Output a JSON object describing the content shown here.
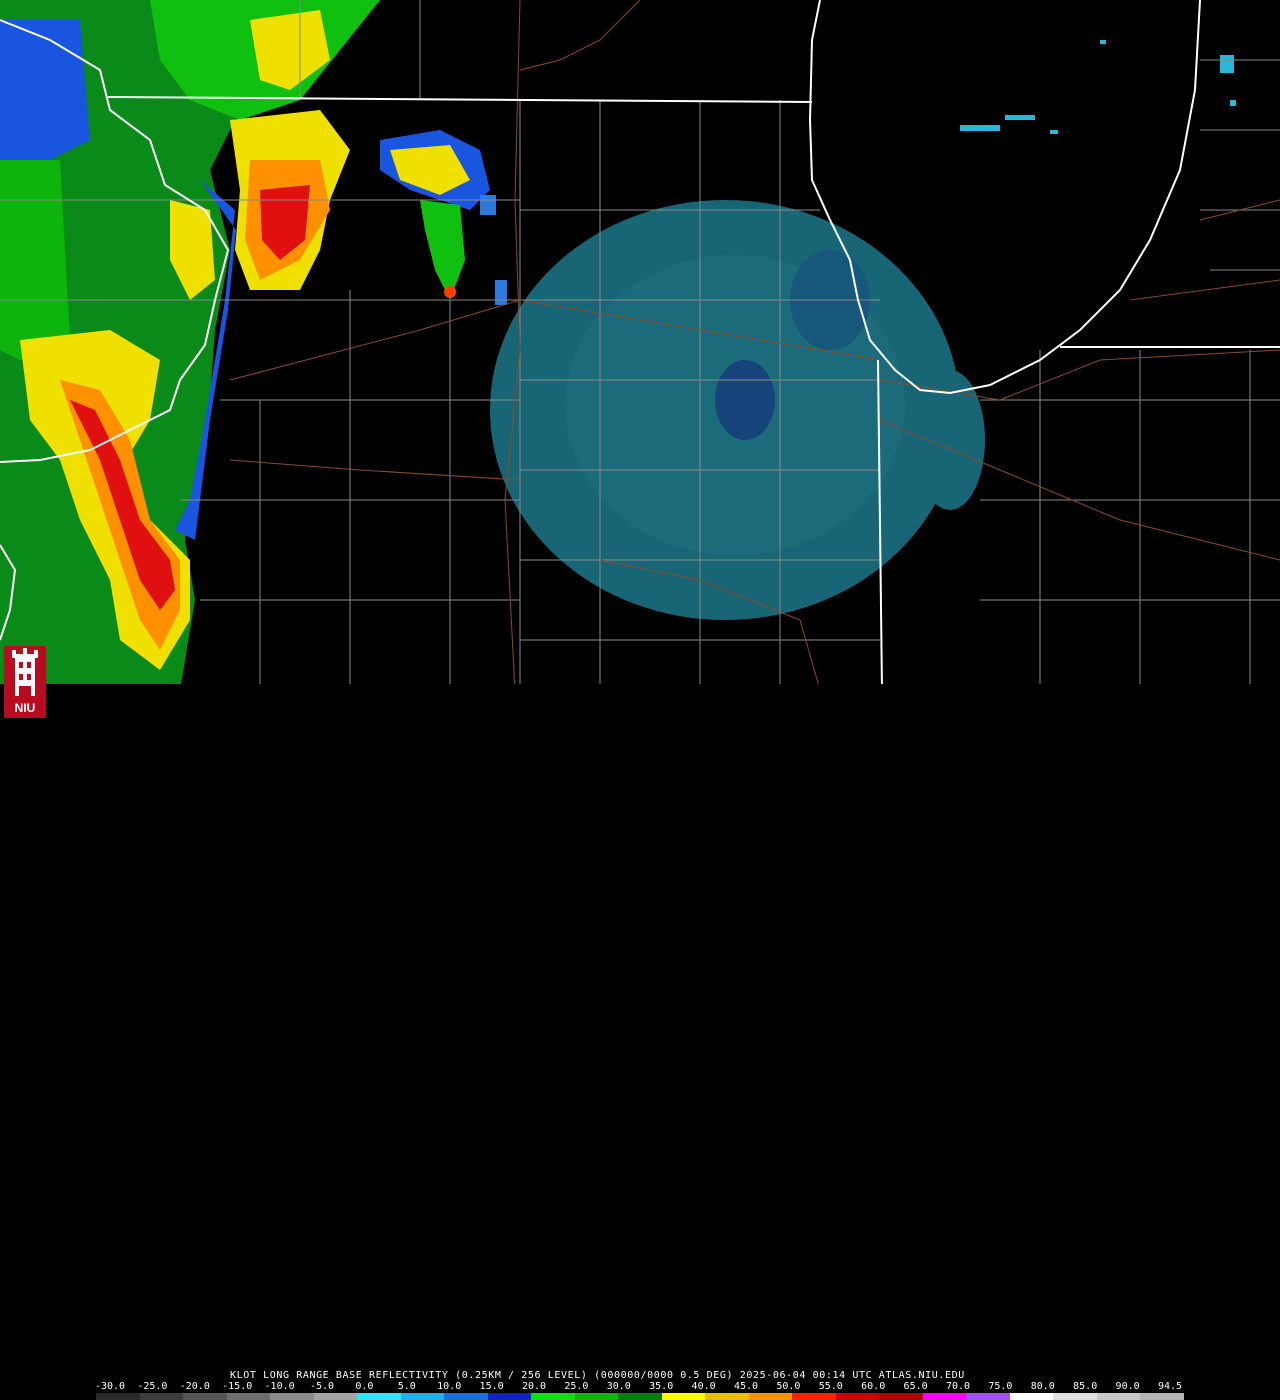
{
  "caption": "KLOT LONG RANGE BASE REFLECTIVITY (0.25KM / 256 LEVEL) (000000/0000 0.5 DEG) 2025-06-04 00:14 UTC  ATLAS.NIU.EDU",
  "scale_ticks": [
    "-30.0",
    "-25.0",
    "-20.0",
    "-15.0",
    "-10.0",
    "-5.0",
    "0.0",
    "5.0",
    "10.0",
    "15.0",
    "20.0",
    "25.0",
    "30.0",
    "35.0",
    "40.0",
    "45.0",
    "50.0",
    "55.0",
    "60.0",
    "65.0",
    "70.0",
    "75.0",
    "80.0",
    "85.0",
    "90.0",
    "94.5"
  ],
  "scale_colors": [
    "#2a2a2a",
    "#3c3c3c",
    "#555555",
    "#6e6e6e",
    "#8a8a8a",
    "#a3a3a3",
    "#2ee6f5",
    "#1ab4e8",
    "#1a6ee0",
    "#1420c8",
    "#10e010",
    "#0cb40c",
    "#087c08",
    "#ffff00",
    "#e6c000",
    "#ff9000",
    "#ff2000",
    "#d00000",
    "#b40000",
    "#ff00ff",
    "#a050ff",
    "#ffffff",
    "#e0e0e0",
    "#c8c8c8",
    "#b4b4b4"
  ],
  "logo": {
    "text": "NIU",
    "name": "niu-logo"
  }
}
